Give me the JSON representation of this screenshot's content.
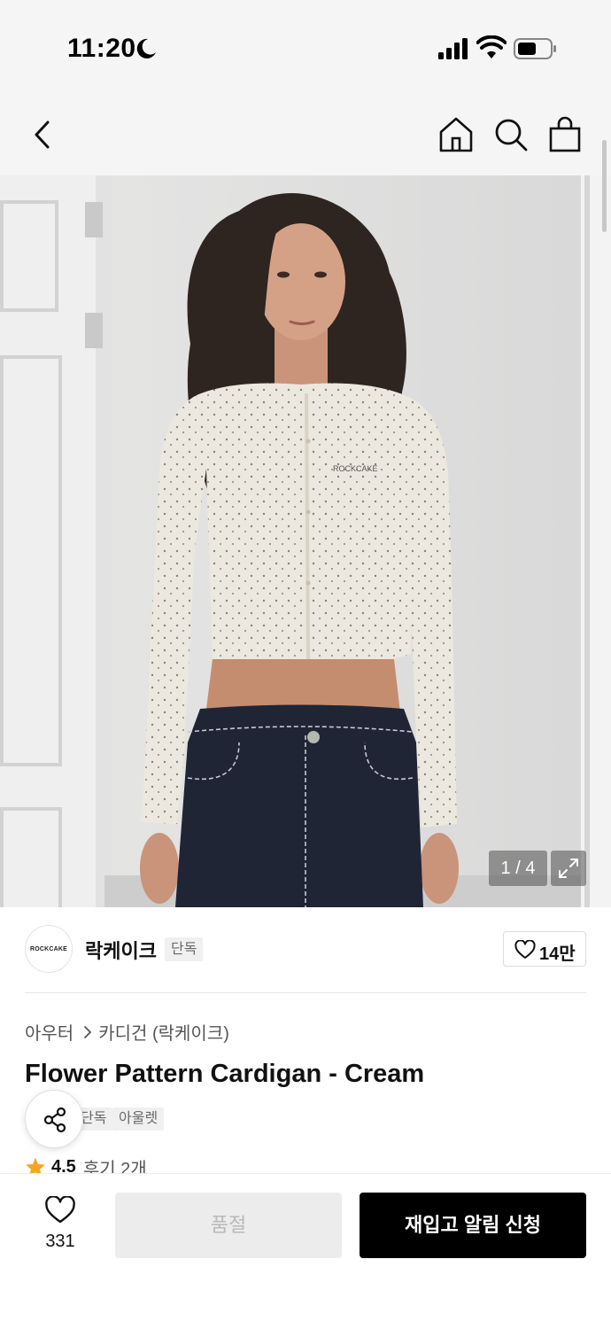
{
  "status_bar": {
    "time": "11:20"
  },
  "nav": {
    "icons": [
      "chevron-left-icon",
      "home-icon",
      "search-icon",
      "shopping-bag-icon"
    ]
  },
  "gallery": {
    "page_indicator": "1 / 4",
    "current_page": 1,
    "total_pages": 4,
    "logo_on_shirt": "ROCKCAKE"
  },
  "brand": {
    "logo_text": "ROCKCAKE",
    "name": "락케이크",
    "badge": "단독",
    "like_count": "14만"
  },
  "product": {
    "breadcrumb": [
      "아우터",
      "카디건 (락케이크)"
    ],
    "title": "Flower Pattern Cardigan - Cream",
    "tags": [
      "단독",
      "아울렛"
    ],
    "rating": "4.5",
    "review_label": "후기 2개"
  },
  "bottom_bar": {
    "wish_count": "331",
    "soldout_label": "품절",
    "restock_label": "재입고 알림 신청"
  },
  "colors": {
    "accent_star": "#f5a623",
    "primary_button": "#000000",
    "disabled_button": "#ececec"
  }
}
